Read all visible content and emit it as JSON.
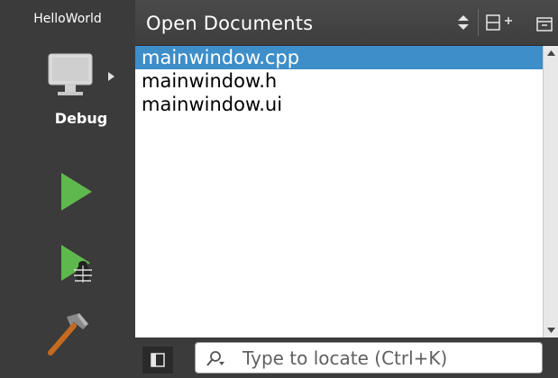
{
  "sidebar": {
    "project_name": "HelloWorld",
    "kit_label": "Debug"
  },
  "panel": {
    "title": "Open Documents"
  },
  "documents": [
    {
      "name": "mainwindow.cpp",
      "selected": true
    },
    {
      "name": "mainwindow.h",
      "selected": false
    },
    {
      "name": "mainwindow.ui",
      "selected": false
    }
  ],
  "locator": {
    "placeholder": "Type to locate (Ctrl+K)",
    "value": ""
  },
  "colors": {
    "selection": "#3d8ec9",
    "run_green": "#5fb84d",
    "sidebar_bg": "#3b3b3b"
  },
  "icons": {
    "kit": "monitor-icon",
    "run": "play-icon",
    "debug": "debug-bug-icon",
    "build": "hammer-icon",
    "sort": "sort-updown-icon",
    "split": "split-add-icon",
    "close": "close-panel-icon",
    "search": "search-icon"
  }
}
